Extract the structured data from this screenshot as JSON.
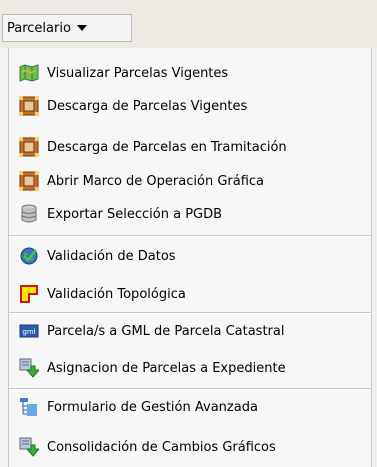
{
  "dropdown": {
    "label": "Parcelario",
    "arrow_icon": "chevron-down-icon"
  },
  "menu": {
    "items": [
      {
        "label": "Visualizar Parcelas Vigentes",
        "icon": "map-icon"
      },
      {
        "label": "Descarga de Parcelas Vigentes",
        "icon": "frame-icon"
      },
      {
        "label": "Descarga de Parcelas en Tramitación",
        "icon": "frame-icon"
      },
      {
        "label": "Abrir Marco de Operación Gráfica",
        "icon": "frame-icon"
      },
      {
        "label": "Exportar Selección a PGDB",
        "icon": "database-icon"
      },
      {
        "label": "Validación de Datos",
        "icon": "globe-check-icon"
      },
      {
        "label": "Validación Topológica",
        "icon": "topology-icon"
      },
      {
        "label": "Parcela/s a GML de Parcela Catastral",
        "icon": "gml-icon"
      },
      {
        "label": "Asignacion de Parcelas a Expediente",
        "icon": "assign-arrow-icon"
      },
      {
        "label": "Formulario de Gestión Avanzada",
        "icon": "tree-form-icon"
      },
      {
        "label": "Consolidación de Cambios Gráficos",
        "icon": "assign-arrow-icon"
      }
    ]
  },
  "colors": {
    "accent_green": "#3fae3f",
    "frame_orange": "#c8702a",
    "topology_yellow": "#ffe600",
    "topology_red": "#d01818",
    "gml_blue": "#2a5db0"
  }
}
